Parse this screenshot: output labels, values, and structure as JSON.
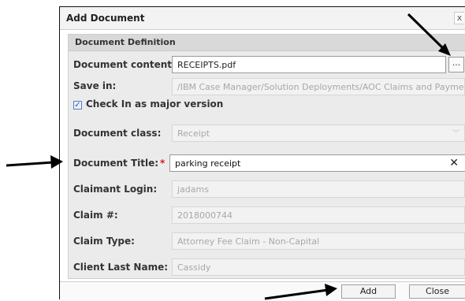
{
  "dialog": {
    "title": "Add Document",
    "close_icon": "x",
    "section_title": "Document Definition"
  },
  "fields": {
    "document_content": {
      "label": "Document content:",
      "value": "RECEIPTS.pdf",
      "browse_label": "..."
    },
    "save_in": {
      "label": "Save in:",
      "value": "/IBM Case Manager/Solution Deployments/AOC Claims and Payments/C"
    },
    "checkin": {
      "label": "Check In as major version",
      "checked": true
    },
    "document_class": {
      "label": "Document class:",
      "value": "Receipt"
    },
    "document_title": {
      "label": "Document Title:",
      "value": "parking receipt"
    },
    "claimant_login": {
      "label": "Claimant Login:",
      "value": "jadams"
    },
    "claim_number": {
      "label": "Claim #:",
      "value": "2018000744"
    },
    "claim_type": {
      "label": "Claim Type:",
      "value": "Attorney Fee Claim - Non-Capital"
    },
    "client_last_name": {
      "label": "Client Last Name:",
      "value": "Cassidy"
    }
  },
  "required_marker": "*",
  "buttons": {
    "add": "Add",
    "close": "Close"
  },
  "colors": {
    "required": "#d32020",
    "panel": "#ebebeb",
    "disabled_text": "#a7a7a7"
  }
}
